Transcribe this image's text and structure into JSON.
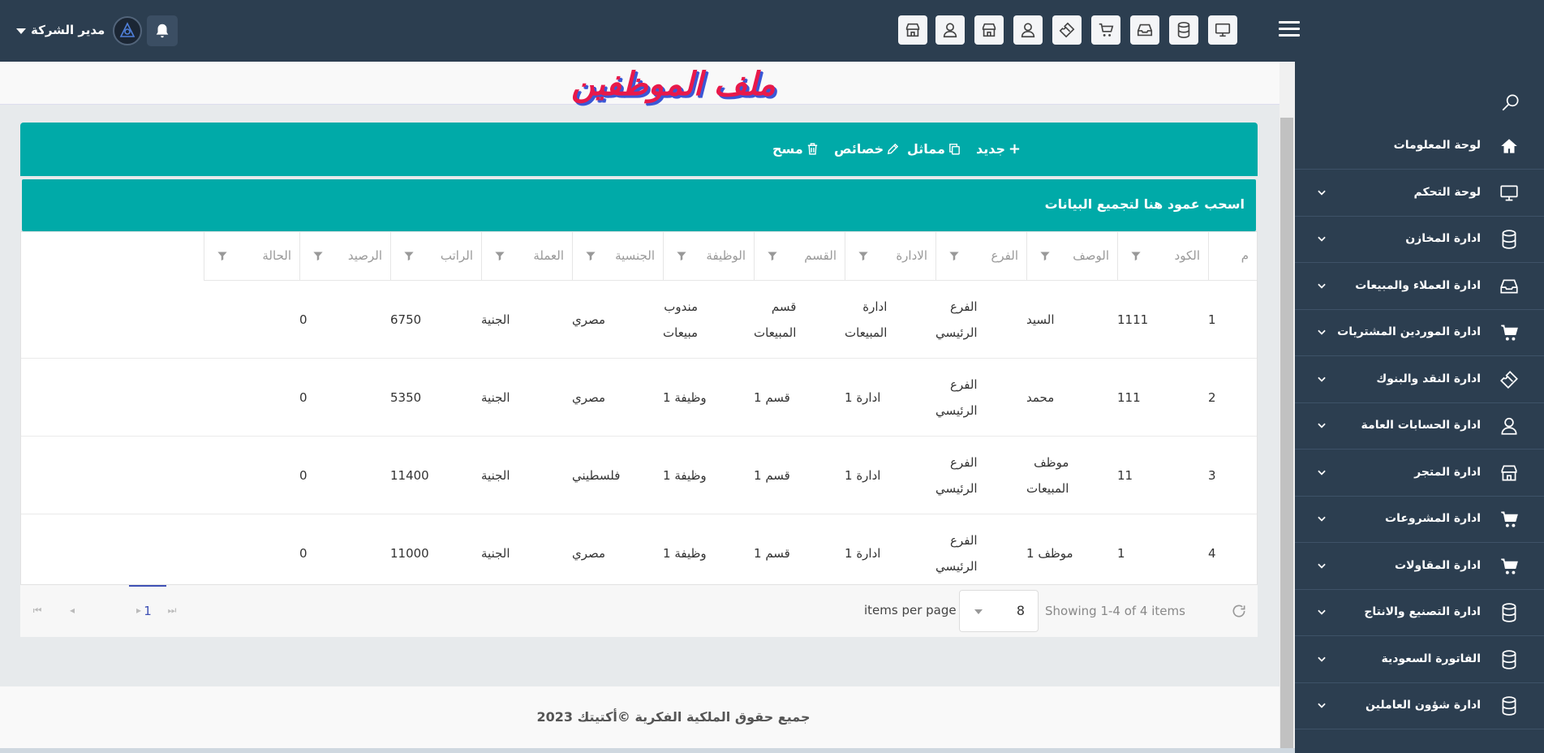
{
  "header": {
    "user_name": "مدير الشركة"
  },
  "page": {
    "title": "ملف الموظفين"
  },
  "toolbar": {
    "new_label": "جديد",
    "duplicate_label": "مماثل",
    "properties_label": "خصائص",
    "delete_label": "مسح",
    "group_hint": "اسحب عمود هنا لتجميع البيانات"
  },
  "sidebar": {
    "items": [
      {
        "label": "لوحة المعلومات",
        "icon": "home-icon"
      },
      {
        "label": "لوحة التحكم",
        "icon": "monitor-icon"
      },
      {
        "label": "ادارة المخازن",
        "icon": "database-icon"
      },
      {
        "label": "ادارة العملاء والمبيعات",
        "icon": "inbox-icon"
      },
      {
        "label": "ادارة الموردين المشتريات",
        "icon": "cart-icon"
      },
      {
        "label": "ادارة النقد والبنوك",
        "icon": "ticket-icon"
      },
      {
        "label": "ادارة الحسابات العامة",
        "icon": "user-icon"
      },
      {
        "label": "ادارة المتجر",
        "icon": "store-icon"
      },
      {
        "label": "ادارة المشروعات",
        "icon": "cart-icon"
      },
      {
        "label": "ادارة المقاولات",
        "icon": "cart-icon"
      },
      {
        "label": "ادارة التصنيع والانتاج",
        "icon": "database-icon"
      },
      {
        "label": "الفاتورة السعودية",
        "icon": "database-icon"
      },
      {
        "label": "ادارة شؤون العاملين",
        "icon": "database-icon"
      }
    ]
  },
  "table": {
    "headers": [
      "م",
      "الكود",
      "الوصف",
      "الفرع",
      "الادارة",
      "القسم",
      "الوظيفة",
      "الجنسية",
      "العملة",
      "الراتب",
      "الرصيد",
      "الحالة"
    ],
    "rows": [
      {
        "num": "1",
        "code": "1111",
        "desc": [
          "السيد"
        ],
        "branch": [
          "الفرع",
          "الرئيسي"
        ],
        "admin": [
          "ادارة",
          "المبيعات"
        ],
        "dept": [
          "قسم",
          "المبيعات"
        ],
        "job": [
          "مندوب",
          "مبيعات"
        ],
        "nationality": "مصري",
        "currency": "الجنية",
        "salary": "6750",
        "balance": "0",
        "status": ""
      },
      {
        "num": "2",
        "code": "111",
        "desc": [
          "محمد"
        ],
        "branch": [
          "الفرع",
          "الرئيسي"
        ],
        "admin": [
          "ادارة 1"
        ],
        "dept": [
          "قسم 1"
        ],
        "job": [
          "وظيفة 1"
        ],
        "nationality": "مصري",
        "currency": "الجنية",
        "salary": "5350",
        "balance": "0",
        "status": ""
      },
      {
        "num": "3",
        "code": "11",
        "desc": [
          "موظف",
          "المبيعات"
        ],
        "branch": [
          "الفرع",
          "الرئيسي"
        ],
        "admin": [
          "ادارة 1"
        ],
        "dept": [
          "قسم 1"
        ],
        "job": [
          "وظيفة 1"
        ],
        "nationality": "فلسطيني",
        "currency": "الجنية",
        "salary": "11400",
        "balance": "0",
        "status": ""
      },
      {
        "num": "4",
        "code": "1",
        "desc": [
          "موظف 1"
        ],
        "branch": [
          "الفرع",
          "الرئيسي"
        ],
        "admin": [
          "ادارة 1"
        ],
        "dept": [
          "قسم 1"
        ],
        "job": [
          "وظيفة 1"
        ],
        "nationality": "مصري",
        "currency": "الجنية",
        "salary": "11000",
        "balance": "0",
        "status": ""
      }
    ]
  },
  "pager": {
    "info": "Showing 1-4 of 4 items",
    "page_size": "8",
    "per_page_label": "items per page",
    "current_page": "1"
  },
  "footer": {
    "text": "جميع حقوق الملكية الفكرية ©أكتيتك 2023"
  },
  "colors": {
    "header_bg": "#2c3e50",
    "accent_teal": "#00aaa8",
    "title_red": "#e8194a",
    "title_shadow_blue": "#3b57d6",
    "pager_accent": "#3f51b5"
  }
}
